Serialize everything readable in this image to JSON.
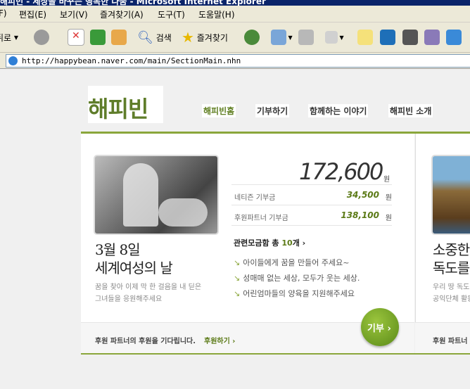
{
  "window": {
    "title": "해피빈 - 세상을 바꾸는 행복한 나눔 - Microsoft Internet Explorer"
  },
  "menu": [
    "F)",
    "편집(E)",
    "보기(V)",
    "즐겨찾기(A)",
    "도구(T)",
    "도움말(H)"
  ],
  "toolbar": {
    "back_label": "뒤로",
    "search_label": "검색",
    "favorites_label": "즐겨찾기"
  },
  "address": {
    "url": "http://happybean.naver.com/main/SectionMain.nhn"
  },
  "site": {
    "logo": "해피빈",
    "nav": [
      "해피빈홈",
      "기부하기",
      "함께하는 이야기",
      "해피빈 소개"
    ]
  },
  "feature": {
    "headline_1": "3월 8일",
    "headline_2": "세계여성의 날",
    "sub_1": "꿈을 찾아 이제 막 한 걸음을 내 딛은",
    "sub_2": "그녀들을 응원해주세요",
    "total": "172,600",
    "unit": "원",
    "rows": [
      {
        "label": "네티즌 기부금",
        "value": "34,500",
        "unit": "원"
      },
      {
        "label": "후원파트너 기부금",
        "value": "138,100",
        "unit": "원"
      }
    ],
    "related_prefix": "관련모금함 총",
    "related_count": "10",
    "related_suffix": "개 ›",
    "items": [
      "아이들에게 꿈을 만들어 주세요~",
      "성매매 없는 세상, 모두가 웃는 세상.",
      "어린엄마들의 양육을 지원해주세요"
    ],
    "donate_label": "기부 ›",
    "bottom_text": "후원 파트너의 후원을 기다립니다.",
    "bottom_link": "후원하기 ›"
  },
  "feature2": {
    "headline_1": "소중한",
    "headline_2": "독도를",
    "sub_1": "우리 땅 독도를",
    "sub_2": "공익단체 활동",
    "bottom_text": "후원 파트너"
  }
}
